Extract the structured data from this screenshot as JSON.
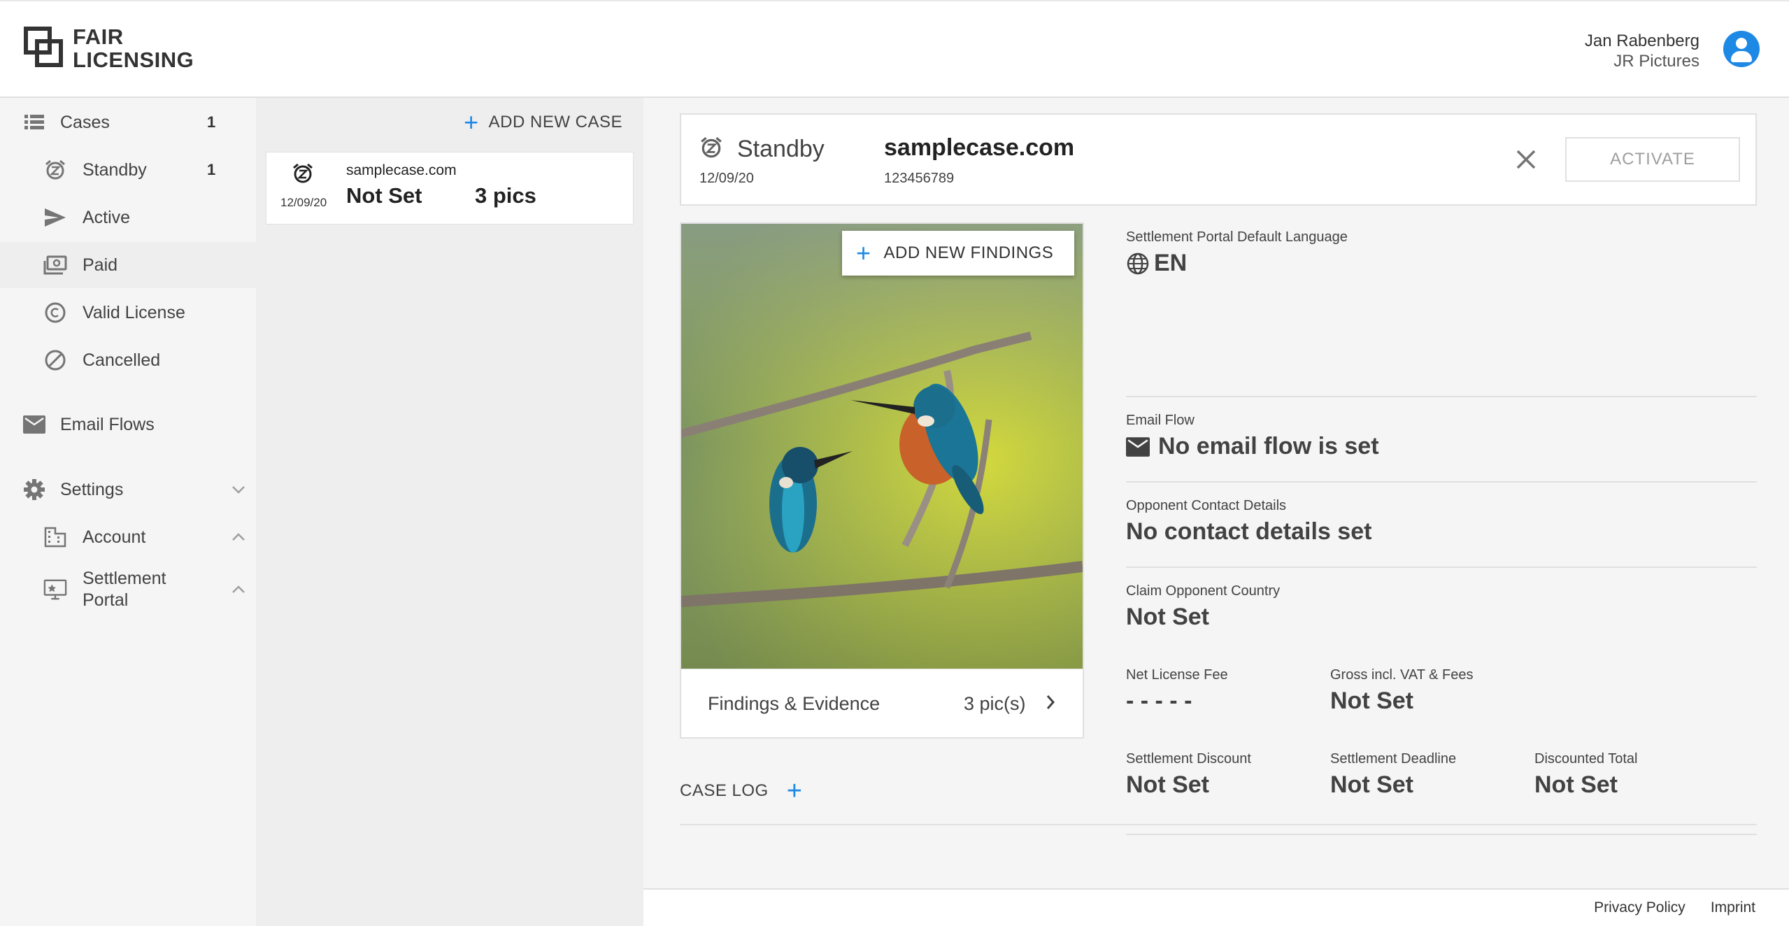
{
  "header": {
    "logo_line1": "FAIR",
    "logo_line2": "LICENSING",
    "user_name": "Jan Rabenberg",
    "user_company": "JR Pictures"
  },
  "sidebar": {
    "cases": {
      "label": "Cases",
      "count": "1"
    },
    "items": [
      {
        "label": "Standby",
        "count": "1",
        "icon": "alarm-snooze-icon"
      },
      {
        "label": "Active",
        "count": "",
        "icon": "send-icon"
      },
      {
        "label": "Paid",
        "count": "",
        "icon": "money-icon"
      },
      {
        "label": "Valid License",
        "count": "",
        "icon": "copyright-icon"
      },
      {
        "label": "Cancelled",
        "count": "",
        "icon": "block-icon"
      }
    ],
    "email_flows": {
      "label": "Email Flows"
    },
    "settings": {
      "label": "Settings"
    },
    "settings_items": [
      {
        "label": "Account"
      },
      {
        "label": "Settlement Portal"
      }
    ]
  },
  "caselist": {
    "add_label": "ADD NEW CASE",
    "cases": [
      {
        "date": "12/09/20",
        "domain": "samplecase.com",
        "status": "Not Set",
        "pics": "3 pics"
      }
    ]
  },
  "case_detail": {
    "state": "Standby",
    "date": "12/09/20",
    "domain": "samplecase.com",
    "id": "123456789",
    "activate_label": "ACTIVATE",
    "add_findings_label": "ADD NEW FINDINGS",
    "findings_label": "Findings & Evidence",
    "findings_count": "3 pic(s)",
    "fields": {
      "language": {
        "label": "Settlement Portal Default Language",
        "value": "EN"
      },
      "email_flow": {
        "label": "Email Flow",
        "value": "No email flow is set"
      },
      "contact": {
        "label": "Opponent Contact Details",
        "value": "No contact details set"
      },
      "country": {
        "label": "Claim Opponent Country",
        "value": "Not Set"
      },
      "net_fee": {
        "label": "Net License Fee",
        "value": "- - - - -"
      },
      "gross": {
        "label": "Gross incl. VAT & Fees",
        "value": "Not Set"
      },
      "discount": {
        "label": "Settlement Discount",
        "value": "Not Set"
      },
      "deadline": {
        "label": "Settlement Deadline",
        "value": "Not Set"
      },
      "discounted_total": {
        "label": "Discounted Total",
        "value": "Not Set"
      }
    },
    "case_log_label": "CASE LOG"
  },
  "footer": {
    "privacy": "Privacy Policy",
    "imprint": "Imprint"
  },
  "colors": {
    "accent": "#1e88e5",
    "sidebar_bg": "#f5f5f5",
    "list_bg": "#eeeeee"
  }
}
